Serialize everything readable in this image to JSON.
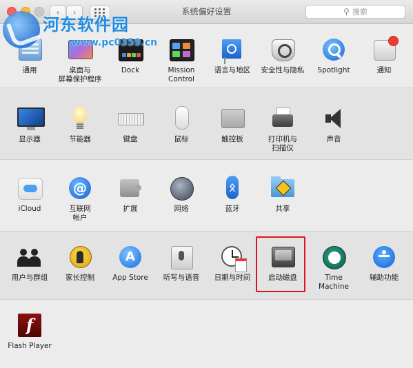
{
  "window": {
    "title": "系统偏好设置",
    "search_placeholder": "搜索"
  },
  "watermark": {
    "title": "河东软件园",
    "url": "www.pc0359.cn"
  },
  "rows": [
    {
      "items": [
        {
          "id": "general",
          "label": "通用",
          "icon": "general-icon"
        },
        {
          "id": "desktop",
          "label": "桌面与\n屏幕保护程序",
          "icon": "desktop-screensaver-icon"
        },
        {
          "id": "dock",
          "label": "Dock",
          "icon": "dock-icon"
        },
        {
          "id": "mission",
          "label": "Mission\nControl",
          "icon": "mission-control-icon"
        },
        {
          "id": "language",
          "label": "语言与地区",
          "icon": "language-region-icon"
        },
        {
          "id": "security",
          "label": "安全性与隐私",
          "icon": "security-privacy-icon"
        },
        {
          "id": "spotlight",
          "label": "Spotlight",
          "icon": "spotlight-icon"
        },
        {
          "id": "notifications",
          "label": "通知",
          "icon": "notifications-icon"
        }
      ]
    },
    {
      "items": [
        {
          "id": "displays",
          "label": "显示器",
          "icon": "displays-icon"
        },
        {
          "id": "energy",
          "label": "节能器",
          "icon": "energy-saver-icon"
        },
        {
          "id": "keyboard",
          "label": "键盘",
          "icon": "keyboard-icon"
        },
        {
          "id": "mouse",
          "label": "鼠标",
          "icon": "mouse-icon"
        },
        {
          "id": "trackpad",
          "label": "触控板",
          "icon": "trackpad-icon"
        },
        {
          "id": "printers",
          "label": "打印机与\n扫描仪",
          "icon": "printer-icon"
        },
        {
          "id": "sound",
          "label": "声音",
          "icon": "sound-icon"
        }
      ]
    },
    {
      "items": [
        {
          "id": "icloud",
          "label": "iCloud",
          "icon": "icloud-icon"
        },
        {
          "id": "internet",
          "label": "互联网\n帐户",
          "icon": "internet-accounts-icon"
        },
        {
          "id": "extensions",
          "label": "扩展",
          "icon": "extensions-icon"
        },
        {
          "id": "network",
          "label": "网络",
          "icon": "network-icon"
        },
        {
          "id": "bluetooth",
          "label": "蓝牙",
          "icon": "bluetooth-icon"
        },
        {
          "id": "sharing",
          "label": "共享",
          "icon": "sharing-icon"
        }
      ]
    },
    {
      "items": [
        {
          "id": "users",
          "label": "用户与群组",
          "icon": "users-groups-icon"
        },
        {
          "id": "parental",
          "label": "家长控制",
          "icon": "parental-controls-icon"
        },
        {
          "id": "appstore",
          "label": "App Store",
          "icon": "app-store-icon"
        },
        {
          "id": "dictation",
          "label": "听写与语音",
          "icon": "dictation-speech-icon"
        },
        {
          "id": "datetime",
          "label": "日期与时间",
          "icon": "date-time-icon"
        },
        {
          "id": "startup",
          "label": "启动磁盘",
          "icon": "startup-disk-icon",
          "highlighted": true
        },
        {
          "id": "timemachine",
          "label": "Time Machine",
          "icon": "time-machine-icon"
        },
        {
          "id": "accessibility",
          "label": "辅助功能",
          "icon": "accessibility-icon"
        }
      ]
    },
    {
      "items": [
        {
          "id": "flash",
          "label": "Flash Player",
          "icon": "flash-player-icon"
        }
      ]
    }
  ],
  "colors": {
    "highlight": "#e0131b",
    "close": "#fc5f57",
    "minimize": "#fdbc2e"
  }
}
